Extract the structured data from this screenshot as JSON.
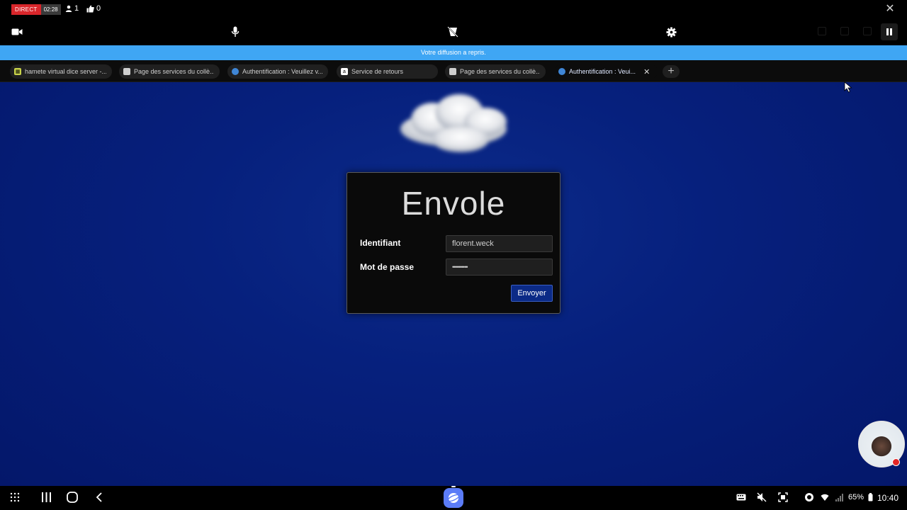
{
  "stream": {
    "live_label": "DIRECT",
    "elapsed": "02:28",
    "viewers": "1",
    "likes": "0"
  },
  "notice": {
    "text": "Votre diffusion a repris."
  },
  "tabs": [
    {
      "label": "hamete virtual dice server -...",
      "favicon_color": "#c8d24a",
      "active": false
    },
    {
      "label": "Page des services du collè...",
      "favicon_color": "#cfcfcf",
      "active": false
    },
    {
      "label": "Authentification : Veuillez v...",
      "favicon_color": "#3f86d6",
      "active": false
    },
    {
      "label": "Service de retours",
      "favicon_color": "#ffffff",
      "active": false
    },
    {
      "label": "Page des services du collè...",
      "favicon_color": "#cfcfcf",
      "active": false
    },
    {
      "label": "Authentification : Veui...",
      "favicon_color": "#3f86d6",
      "active": true
    }
  ],
  "login": {
    "title": "Envole",
    "username_label": "Identifiant",
    "username_value": "florent.weck",
    "password_label": "Mot de passe",
    "password_value": "••••••••••",
    "submit_label": "Envoyer"
  },
  "statusbar": {
    "battery": "65%",
    "time": "10:40"
  },
  "colors": {
    "page_bg": "#06207d",
    "notice_bg": "#3fa6f4",
    "live_red": "#d9262b",
    "button_bg": "#0b2a86"
  }
}
